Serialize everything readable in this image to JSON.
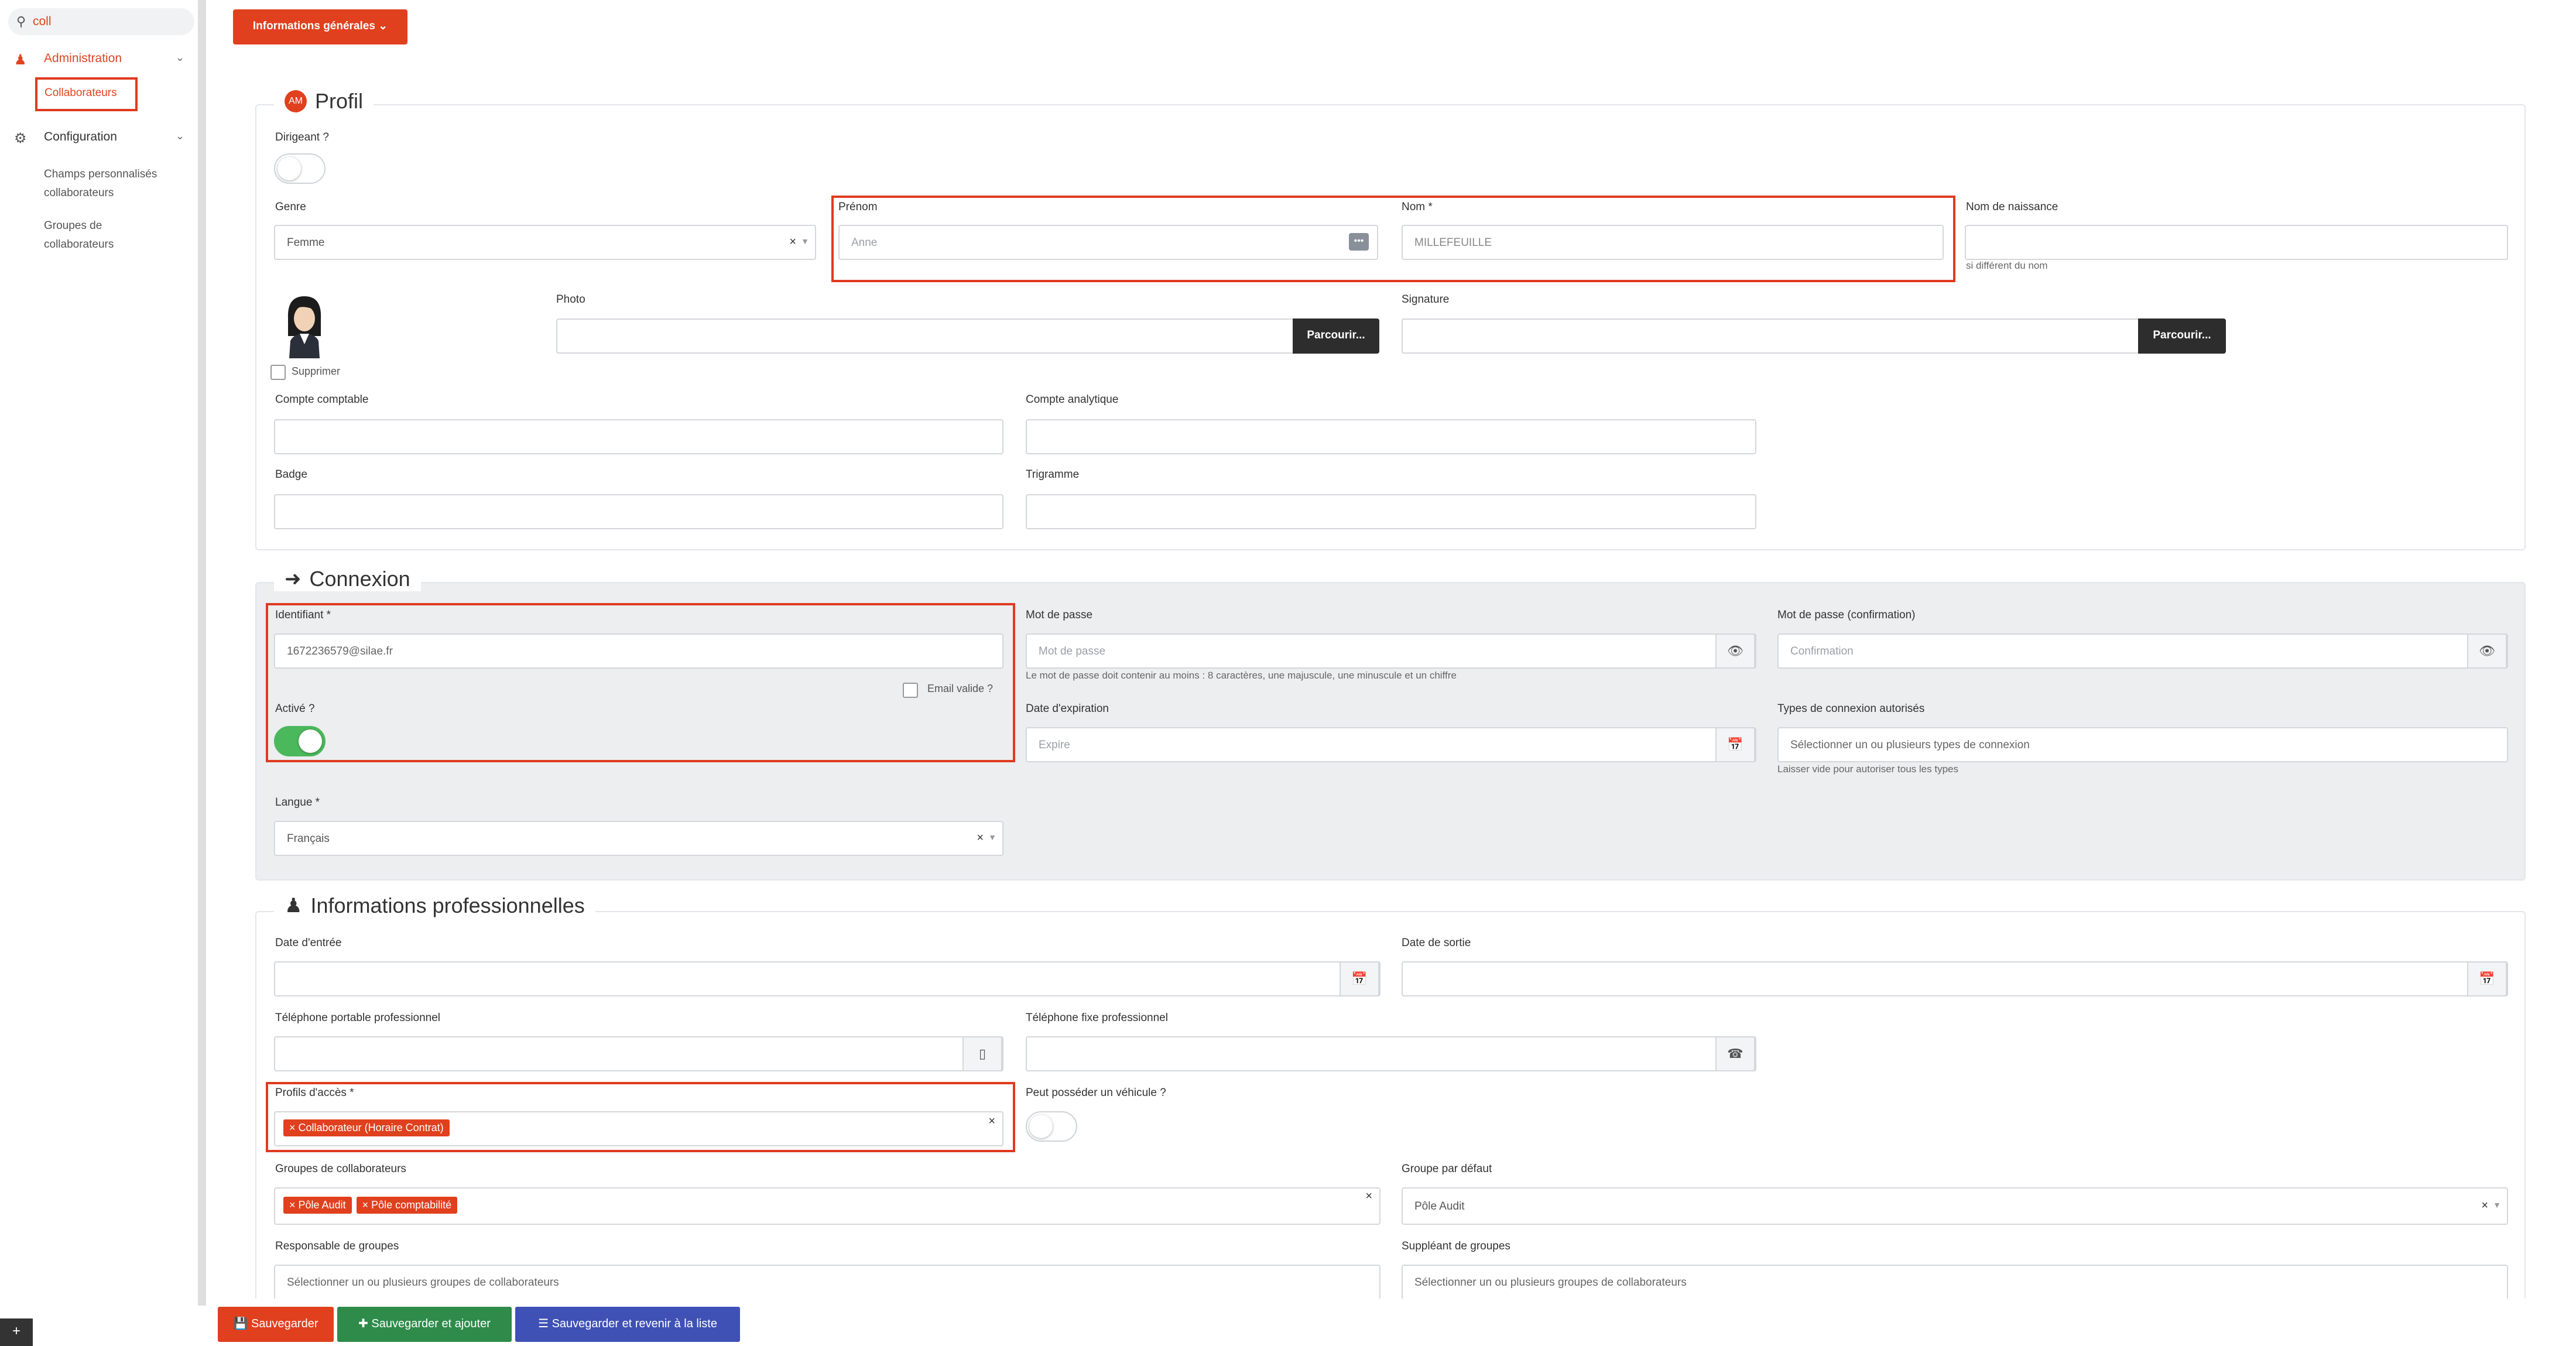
{
  "sidebar": {
    "search_value": "coll",
    "items": [
      {
        "label": "Administration",
        "icon": "user-admin-icon"
      },
      {
        "label": "Collaborateurs"
      },
      {
        "label": "Configuration",
        "icon": "gears-icon"
      },
      {
        "label": "Champs personnalisés collaborateurs"
      },
      {
        "label": "Groupes de collaborateurs"
      }
    ],
    "toggle_label": "+"
  },
  "header": {
    "infos_button": "Informations générales ⌄"
  },
  "profil": {
    "legend": "Profil",
    "avatar_initials": "AM",
    "dirigeant_label": "Dirigeant ?",
    "dirigeant_on": false,
    "genre_label": "Genre",
    "genre_value": "Femme",
    "prenom_label": "Prénom",
    "prenom_placeholder": "Anne",
    "nom_label": "Nom *",
    "nom_value": "MILLEFEUILLE",
    "nom_naissance_label": "Nom de naissance",
    "nom_naissance_help": "si différent du nom",
    "photo_label": "Photo",
    "browse_label": "Parcourir...",
    "signature_label": "Signature",
    "supprimer_label": "Supprimer",
    "compte_comptable_label": "Compte comptable",
    "compte_analytique_label": "Compte analytique",
    "badge_label": "Badge",
    "trigramme_label": "Trigramme"
  },
  "connexion": {
    "legend": "Connexion",
    "identifiant_label": "Identifiant *",
    "identifiant_value": "1672236579@silae.fr",
    "email_valide_label": "Email valide ?",
    "active_label": "Activé ?",
    "active_on": true,
    "mdp_label": "Mot de passe",
    "mdp_placeholder": "Mot de passe",
    "mdp_help": "Le mot de passe doit contenir au moins : 8 caractères, une majuscule, une minuscule et un chiffre",
    "mdp_conf_label": "Mot de passe (confirmation)",
    "mdp_conf_placeholder": "Confirmation",
    "expiration_label": "Date d'expiration",
    "expiration_placeholder": "Expire",
    "types_label": "Types de connexion autorisés",
    "types_placeholder": "Sélectionner un ou plusieurs types de connexion",
    "types_help": "Laisser vide pour autoriser tous les types",
    "langue_label": "Langue *",
    "langue_value": "Français"
  },
  "pro": {
    "legend": "Informations professionnelles",
    "date_entree_label": "Date d'entrée",
    "date_sortie_label": "Date de sortie",
    "tel_portable_label": "Téléphone portable professionnel",
    "tel_fixe_label": "Téléphone fixe professionnel",
    "profils_label": "Profils d'accès *",
    "profils_tags": [
      "× Collaborateur (Horaire Contrat)"
    ],
    "vehicule_label": "Peut posséder un véhicule ?",
    "vehicule_on": false,
    "groupes_label": "Groupes de collaborateurs",
    "groupes_tags": [
      "× Pôle Audit",
      "× Pôle comptabilité"
    ],
    "groupe_defaut_label": "Groupe par défaut",
    "groupe_defaut_value": "Pôle Audit",
    "responsable_label": "Responsable de groupes",
    "responsable_placeholder": "Sélectionner un ou plusieurs groupes de collaborateurs",
    "suppleant_label": "Suppléant de groupes",
    "suppleant_placeholder": "Sélectionner un ou plusieurs groupes de collaborateurs"
  },
  "footer": {
    "save": "Sauvegarder",
    "save_add": "Sauvegarder et ajouter",
    "save_back": "Sauvegarder et revenir à la liste"
  },
  "colors": {
    "accent": "#e0401e",
    "green": "#2e8b4a",
    "blue": "#3f51b5",
    "toggle_on": "#4cb85c"
  }
}
